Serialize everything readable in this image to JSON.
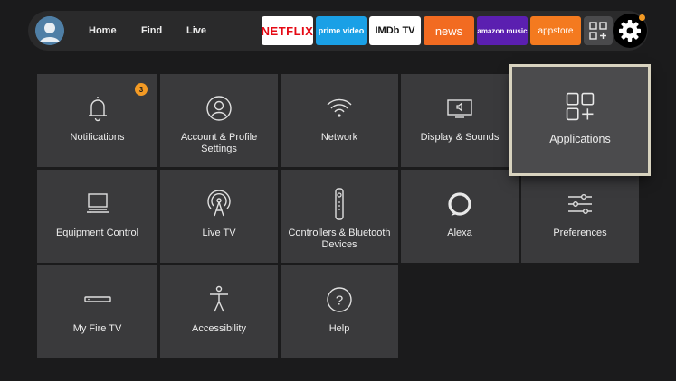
{
  "nav": {
    "home": "Home",
    "find": "Find",
    "live": "Live"
  },
  "apps": [
    {
      "label": "NETFLIX",
      "bg": "#ffffff",
      "fg": "#e50914"
    },
    {
      "label": "prime video",
      "bg": "#1aa0e6",
      "fg": "#ffffff"
    },
    {
      "label": "IMDb TV",
      "bg": "#ffffff",
      "fg": "#111111"
    },
    {
      "label": "news",
      "bg": "#f26b21",
      "fg": "#ffffff"
    },
    {
      "label": "amazon music",
      "bg": "#5b1fb0",
      "fg": "#ffffff"
    },
    {
      "label": "appstore",
      "bg": "#f47a1f",
      "fg": "#ffffff"
    }
  ],
  "settings": {
    "notifications": {
      "label": "Notifications",
      "badge": "3"
    },
    "account": {
      "label": "Account & Profile Settings"
    },
    "network": {
      "label": "Network"
    },
    "display": {
      "label": "Display & Sounds"
    },
    "applications": {
      "label": "Applications"
    },
    "equipment": {
      "label": "Equipment Control"
    },
    "livetv": {
      "label": "Live TV"
    },
    "controllers": {
      "label": "Controllers & Bluetooth Devices"
    },
    "alexa": {
      "label": "Alexa"
    },
    "preferences": {
      "label": "Preferences"
    },
    "myfiretv": {
      "label": "My Fire TV"
    },
    "accessibility": {
      "label": "Accessibility"
    },
    "help": {
      "label": "Help"
    }
  },
  "colors": {
    "accent": "#f39a24",
    "focus_border": "#d8d3bf"
  }
}
